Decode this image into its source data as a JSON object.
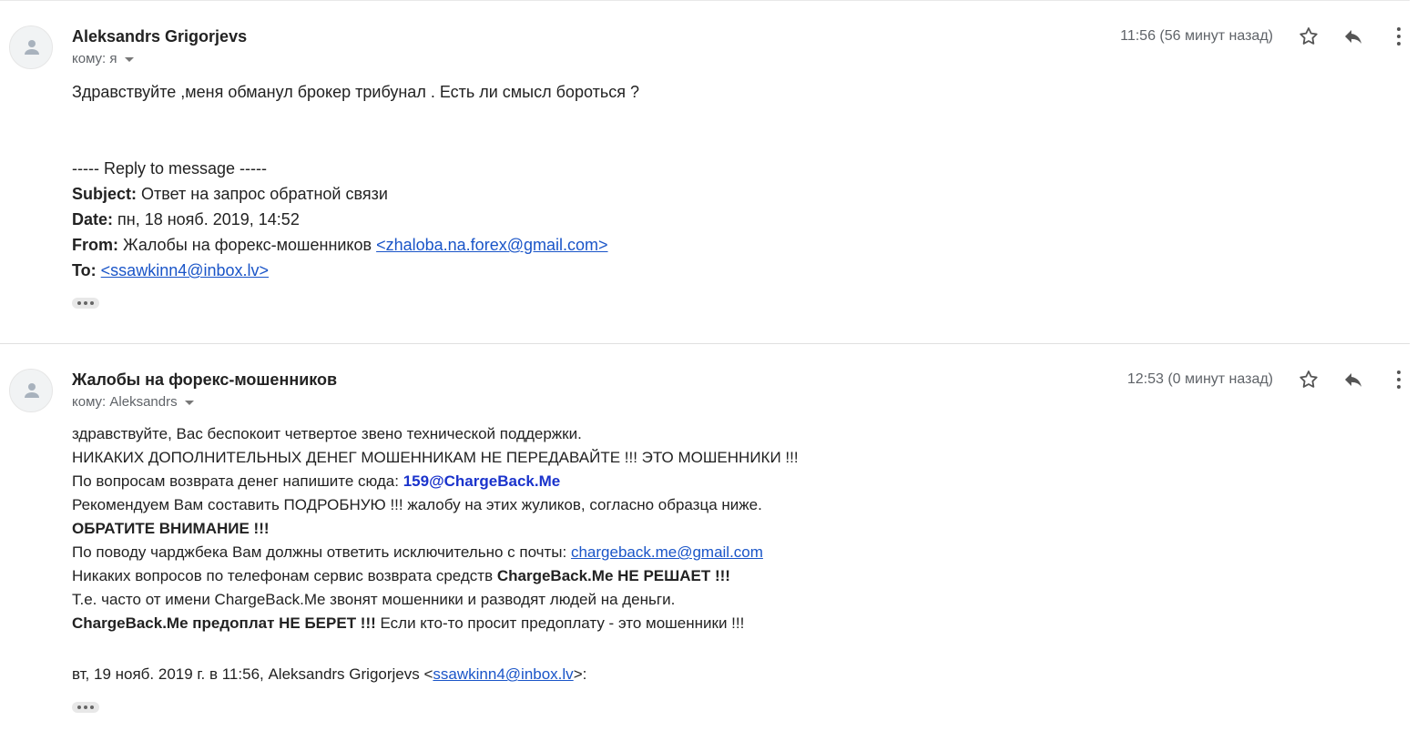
{
  "messages": [
    {
      "sender": "Aleksandrs Grigorjevs",
      "to": "кому: я",
      "time": "11:56 (56 минут назад)",
      "greeting": "Здравствуйте ,меня обманул брокер трибунал . Есть ли смысл бороться ?",
      "reply_header": "----- Reply to message -----",
      "subject_label": "Subject:",
      "subject_value": " Ответ на запрос обратной связи",
      "date_label": "Date:",
      "date_value": " пн, 18 нояб. 2019, 14:52",
      "from_label": "From:",
      "from_name": " Жалобы на форекс-мошенников ",
      "from_email": "<zhaloba.na.forex@gmail.com>",
      "to_label": "To:",
      "to_email": "<ssawkinn4@inbox.lv>"
    },
    {
      "sender": "Жалобы на форекс-мошенников",
      "to": "кому: Aleksandrs",
      "time": "12:53 (0 минут назад)",
      "line1": "здравствуйте, Вас беспокоит четвертое звено технической поддержки.",
      "line2": "НИКАКИХ ДОПОЛНИТЕЛЬНЫХ ДЕНЕГ МОШЕННИКАМ НЕ ПЕРЕДАВАЙТЕ !!! ЭТО МОШЕННИКИ !!!",
      "line3_text": "По вопросам возврата денег напишите сюда: ",
      "line3_link": "159@ChargeBack.Me",
      "line4": "Рекомендуем Вам составить ПОДРОБНУЮ !!! жалобу на этих жуликов, согласно образца ниже.",
      "line5": "ОБРАТИТЕ ВНИМАНИЕ !!!",
      "line6_text": "По поводу чарджбека Вам должны ответить исключительно с почты: ",
      "line6_link": "chargeback.me@gmail.com",
      "line7_text": "Никаких вопросов по телефонам сервис возврата средств ",
      "line7_bold": "ChargeBack.Me НЕ РЕШАЕТ !!!",
      "line8": "Т.е. часто от имени ChargeBack.Me звонят мошенники и разводят людей на деньги.",
      "line9_bold": "ChargeBack.Me предоплат НЕ БЕРЕТ !!!",
      "line9_text": " Если кто-то просит предоплату - это мошенники !!!",
      "quote_prefix": "вт, 19 нояб. 2019 г. в 11:56, Aleksandrs Grigorjevs <",
      "quote_email": "ssawkinn4@inbox.lv",
      "quote_suffix": ">:"
    }
  ],
  "icons": [
    "avatar-icon",
    "star-icon",
    "reply-icon",
    "more-vert-icon",
    "ellipsis-icon"
  ]
}
